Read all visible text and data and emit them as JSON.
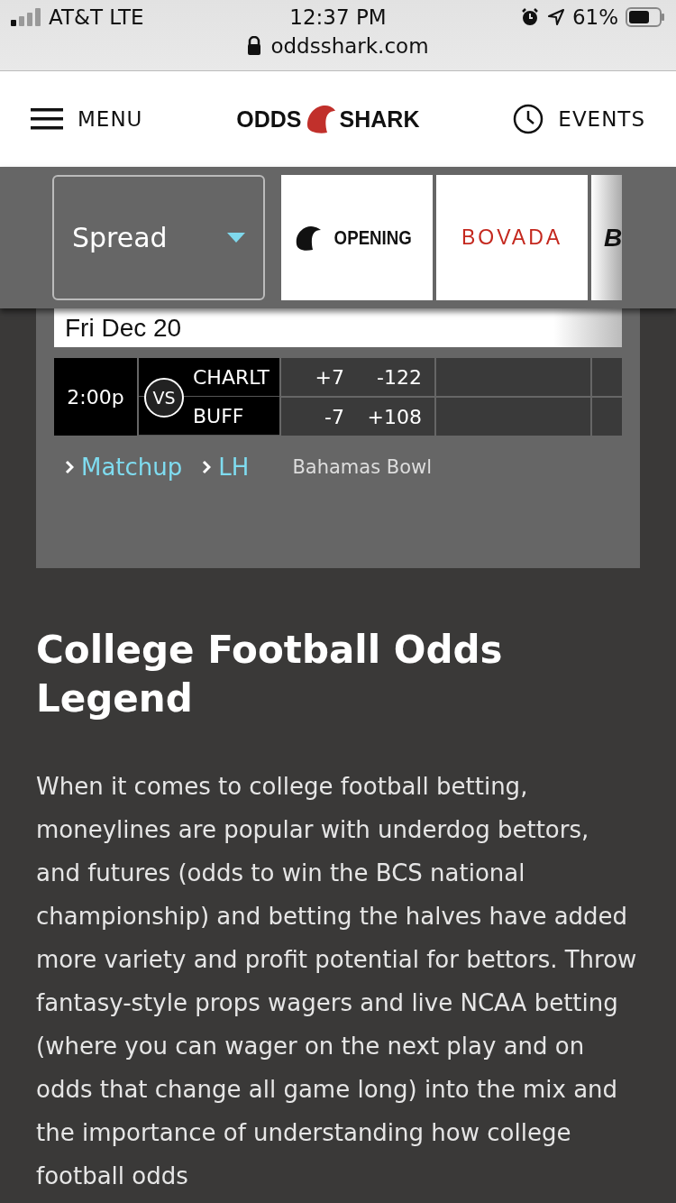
{
  "status_bar": {
    "carrier": "AT&T LTE",
    "time": "12:37 PM",
    "battery": "61%"
  },
  "address_bar": {
    "url": "oddsshark.com"
  },
  "nav": {
    "menu": "MENU",
    "logo": [
      "ODDS",
      "SHARK"
    ],
    "events": "EVENTS"
  },
  "filter": {
    "market": "Spread",
    "books": [
      {
        "name": "OPENING",
        "kind": "opening"
      },
      {
        "name": "BOVADA",
        "kind": "bovada"
      },
      {
        "name": "B",
        "kind": "partial"
      }
    ]
  },
  "game": {
    "date": "Fri Dec 20",
    "time": "2:00p",
    "vs": "VS",
    "teams": [
      {
        "name": "CHARLT",
        "spread": "+7",
        "moneyline": "-122"
      },
      {
        "name": "BUFF",
        "spread": "-7",
        "moneyline": "+108"
      }
    ],
    "links": [
      "Matchup",
      "LH"
    ],
    "event": "Bahamas Bowl"
  },
  "legend": {
    "title": "College Football Odds Legend",
    "body": "When it comes to college football betting, moneylines are popular with underdog bettors, and futures (odds to win the BCS national championship) and betting the halves have added more variety and profit potential for bettors. Throw fantasy-style props wagers and live NCAA betting (where you can wager on the next play and on odds that change all game long) into the mix and the importance of understanding how college football odds"
  }
}
